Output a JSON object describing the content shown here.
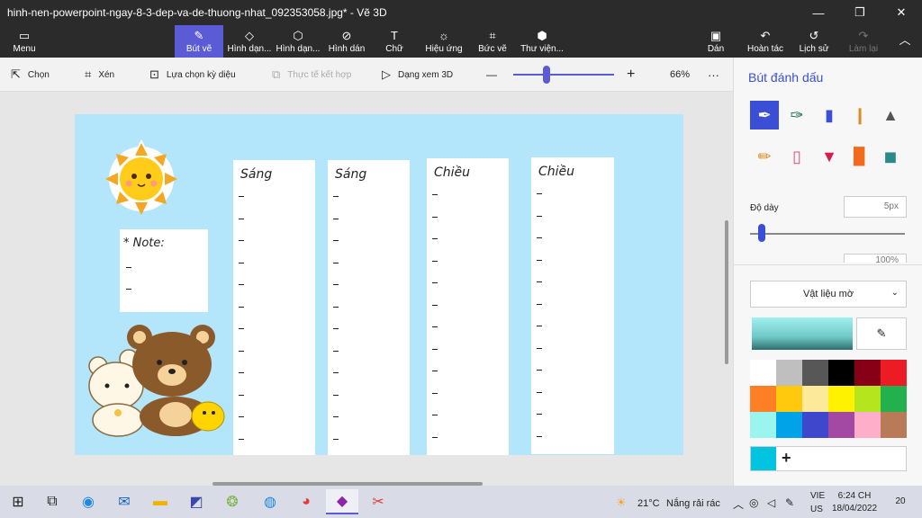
{
  "window": {
    "title": "hinh-nen-powerpoint-ngay-8-3-dep-va-de-thuong-nhat_092353058.jpg* - Vẽ 3D",
    "minimize": "—",
    "maximize": "❐",
    "close": "✕"
  },
  "ribbon": {
    "menu": "Menu",
    "tabs": [
      "Bút vẽ",
      "Hình dạn...",
      "Hình dạn...",
      "Hình dán",
      "Chữ",
      "Hiệu ứng",
      "Bức vẽ",
      "Thư viện..."
    ],
    "paste": "Dán",
    "undo": "Hoàn tác",
    "history": "Lịch sử",
    "redo": "Làm lại"
  },
  "toolbar": {
    "select": "Chọn",
    "crop": "Xén",
    "magic_select": "Lựa chọn kỳ diệu",
    "mixed_reality": "Thực tế kết hợp",
    "view_3d": "Dạng xem 3D",
    "zoom_minus": "—",
    "zoom_plus": "+",
    "zoom_value": "66%",
    "more": "···"
  },
  "zoom": {
    "level_fraction": 0.33
  },
  "canvas": {
    "note_title": "* Note:",
    "columns": [
      "Sáng",
      "Sáng",
      "Chiều",
      "Chiều"
    ]
  },
  "panel": {
    "title": "Bút đánh dấu",
    "thickness_label": "Độ dày",
    "thickness_value": "5px",
    "opacity_value": "100%",
    "material": "Vật liệu mờ",
    "thickness_fraction": 0.05,
    "palette": [
      "#ffffff",
      "#bfbfbf",
      "#575757",
      "#000000",
      "#880015",
      "#ed1c24",
      "#ff7f27",
      "#ffc90e",
      "#fde99a",
      "#fff200",
      "#b5e61d",
      "#22b14c",
      "#99f5ee",
      "#00a2e8",
      "#3f48cc",
      "#a349a4",
      "#ffaec9",
      "#b97a57"
    ],
    "custom_color": "#00c4e0",
    "add_color": "+"
  },
  "taskbar": {
    "weather_temp": "21°C",
    "weather_text": "Nắng rải rác",
    "lang_top": "VIE",
    "lang_bottom": "US",
    "time": "6:24 CH",
    "date": "18/04/2022",
    "notifications": "20"
  }
}
